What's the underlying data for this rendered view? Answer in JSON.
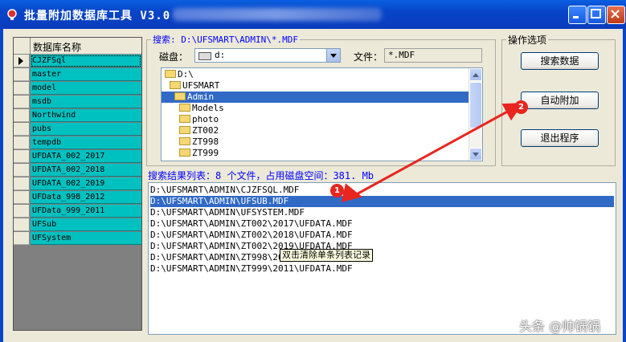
{
  "window": {
    "title": "批量附加数据库工具 V3.0"
  },
  "grid": {
    "header": "数据库名称",
    "rows": [
      "CJZFSql",
      "master",
      "model",
      "msdb",
      "Northwind",
      "pubs",
      "tempdb",
      "UFDATA_002_2017",
      "UFDATA_002_2018",
      "UFDATA_002_2019",
      "UFData_998_2012",
      "UFData_999_2011",
      "UFSub",
      "UFSystem"
    ]
  },
  "search": {
    "label": "搜索: D:\\UFSMART\\ADMIN\\*.MDF",
    "drive_label": "磁盘：",
    "drive_value": "d:",
    "file_label": "文件：",
    "file_value": "*.MDF"
  },
  "dirs": [
    "D:\\",
    "UFSMART",
    "Admin",
    "Models",
    "photo",
    "ZT002",
    "ZT998",
    "ZT999"
  ],
  "options": {
    "label": "操作选项",
    "search_button": "搜索数据",
    "attach_button": "自动附加",
    "exit_button": "退出程序"
  },
  "results": {
    "summary": "搜索结果列表：8 个文件，占用磁盘空间：381. Mb",
    "items": [
      "D:\\UFSMART\\ADMIN\\CJZFSQL.MDF",
      "D:\\UFSMART\\ADMIN\\UFSUB.MDF",
      "D:\\UFSMART\\ADMIN\\UFSYSTEM.MDF",
      "D:\\UFSMART\\ADMIN\\ZT002\\2017\\UFDATA.MDF",
      "D:\\UFSMART\\ADMIN\\ZT002\\2018\\UFDATA.MDF",
      "D:\\UFSMART\\ADMIN\\ZT002\\2019\\UFDATA.MDF",
      "D:\\UFSMART\\ADMIN\\ZT998\\2012\\UFDATA.MDF",
      "D:\\UFSMART\\ADMIN\\ZT999\\2011\\UFDATA.MDF"
    ],
    "tooltip": "双击清除单条列表记录"
  },
  "annotations": {
    "badge1": "1",
    "badge2": "2",
    "color": "#e8251f"
  },
  "watermark": "头条 @帅锅锅"
}
